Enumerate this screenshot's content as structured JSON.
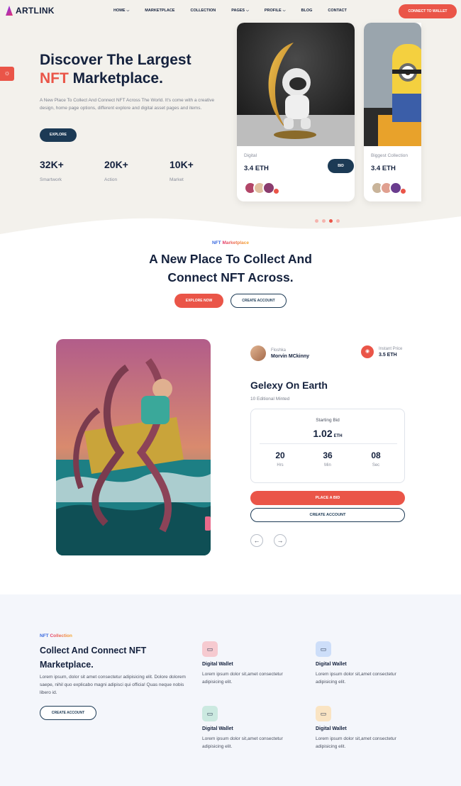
{
  "brand": {
    "name": "ARTLINK"
  },
  "nav": {
    "items": [
      {
        "label": "HOME",
        "has_dropdown": true
      },
      {
        "label": "MARKETPLACE",
        "has_dropdown": false
      },
      {
        "label": "COLLECTION",
        "has_dropdown": false
      },
      {
        "label": "PAGES",
        "has_dropdown": true
      },
      {
        "label": "PROFILE",
        "has_dropdown": true
      },
      {
        "label": "BLOG",
        "has_dropdown": false
      },
      {
        "label": "CONTACT",
        "has_dropdown": false
      }
    ],
    "cta": "CONNECT TO WALLET"
  },
  "hero": {
    "title_line1": "Discover The Largest",
    "title_highlight": "NFT",
    "title_line2_rest": "Marketplace.",
    "description": "A New Place To Collect And Connect NFT Across The World. It's come with a creative design, home page options, different explore and digital asset pages and items.",
    "explore_label": "EXPLORE",
    "stats": [
      {
        "value": "32K+",
        "label": "Smartwork"
      },
      {
        "value": "20K+",
        "label": "Action"
      },
      {
        "value": "10K+",
        "label": "Market"
      }
    ],
    "cards": [
      {
        "category": "Digital",
        "price": "3.4 ETH",
        "bid_label": "BID"
      },
      {
        "category": "Biggest Collection",
        "price": "3.4 ETH"
      }
    ],
    "carousel_active_index": 2,
    "carousel_count": 4
  },
  "marketplace": {
    "eyebrow_a": "NFT",
    "eyebrow_b": "Marketplace",
    "title_line1": "A New Place To Collect And",
    "title_line2": "Connect NFT Across.",
    "explore_now": "EXPLORE NOW",
    "create_account": "CREATE ACCOUNT"
  },
  "auction": {
    "creator_label": "Floshka",
    "creator_name": "Morvin MCkinny",
    "price_label": "Instant Price",
    "price_value": "3.5 ETH",
    "title": "Gelexy On Earth",
    "subtitle": "10 Editional Minted",
    "starting_bid_label": "Starting Bid",
    "starting_bid_value": "1.02",
    "starting_bid_unit": "ETH",
    "countdown": [
      {
        "value": "20",
        "label": "Hrs"
      },
      {
        "value": "36",
        "label": "Min"
      },
      {
        "value": "08",
        "label": "Sec"
      }
    ],
    "place_bid": "PLACE A BID",
    "create_account": "CREATE ACCOUNT"
  },
  "collection": {
    "eyebrow_a": "NFT",
    "eyebrow_b": "Collection",
    "title": "Collect And Connect NFT Marketplace.",
    "description": "Lorem ipsum, dolor sit amet consectetur adipisicing elit. Dolore dolorem saepe, nihil quo explicabo magni adipisci qui officia! Quas neque nobis libero id.",
    "create_account": "CREATE ACCOUNT",
    "features": [
      {
        "title": "Digital Wallet",
        "description": "Lorem ipsum dolor sit,amet consectetur adipisicing elit.",
        "icon": "wallet-icon",
        "color": "#f7c6cc"
      },
      {
        "title": "Digital Wallet",
        "description": "Lorem ipsum dolor sit,amet consectetur adipisicing elit.",
        "icon": "wallet-icon",
        "color": "#c9dcf9"
      },
      {
        "title": "Digital Wallet",
        "description": "Lorem ipsum dolor sit,amet consectetur adipisicing elit.",
        "icon": "wallet-icon",
        "color": "#c7e8de"
      },
      {
        "title": "Digital Wallet",
        "description": "Lorem ipsum dolor sit,amet consectetur adipisicing elit.",
        "icon": "wallet-icon",
        "color": "#fbe3bd"
      }
    ]
  },
  "colors": {
    "accent": "#ea5548",
    "navy": "#1c3a55",
    "text": "#14213d"
  }
}
